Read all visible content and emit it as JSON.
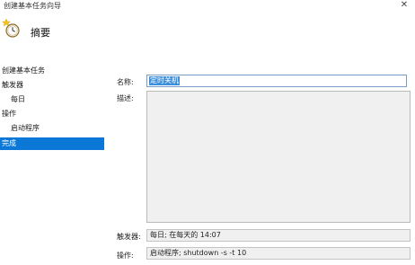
{
  "window": {
    "title": "创建基本任务向导",
    "close_glyph": "✕"
  },
  "header": {
    "title": "摘要",
    "icon": "wizard-clock-icon"
  },
  "nav": {
    "items": [
      {
        "label": "创建基本任务",
        "indent": 0,
        "selected": false
      },
      {
        "label": "触发器",
        "indent": 0,
        "selected": false
      },
      {
        "label": "每日",
        "indent": 1,
        "selected": false
      },
      {
        "label": "操作",
        "indent": 0,
        "selected": false
      },
      {
        "label": "启动程序",
        "indent": 1,
        "selected": false
      },
      {
        "label": "完成",
        "indent": 0,
        "selected": true
      }
    ]
  },
  "form": {
    "name_label": "名称:",
    "name_value": "定时关机",
    "desc_label": "描述:",
    "desc_value": "",
    "trigger_label": "触发器:",
    "trigger_value": "每日; 在每天的 14:07",
    "action_label": "操作:",
    "action_value": "启动程序; shutdown -s -t 10"
  },
  "colors": {
    "accent": "#0b78d8",
    "selection": "#3b8fdc",
    "field_bg": "#f0f0f0"
  }
}
